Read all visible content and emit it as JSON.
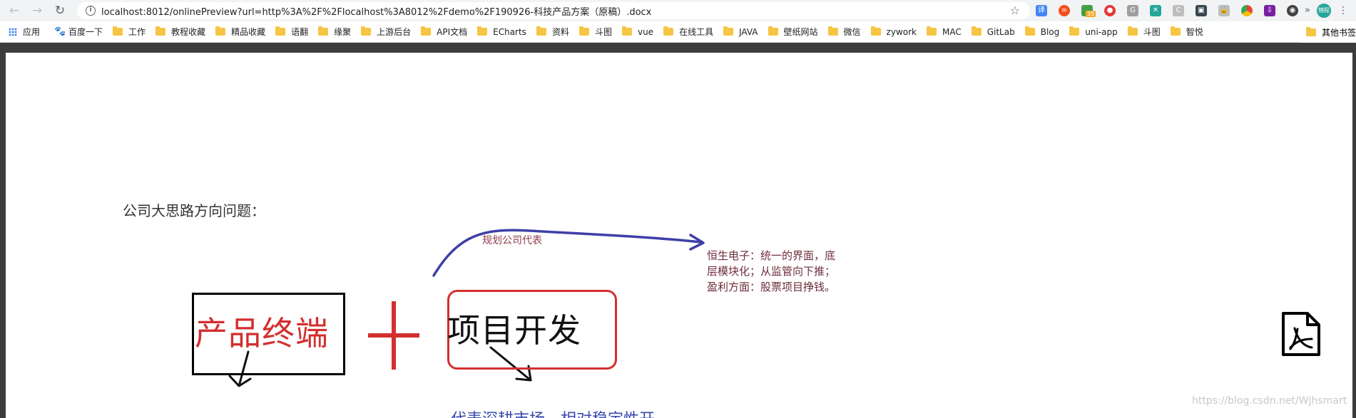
{
  "browser": {
    "url": "localhost:8012/onlinePreview?url=http%3A%2F%2Flocalhost%3A8012%2Fdemo%2F190926-科技产品方案（原稿）.docx",
    "extension_badge": "35",
    "profile_label": "锦程"
  },
  "bookmarks": {
    "apps_label": "应用",
    "baidu_label": "百度一下",
    "folders": [
      "工作",
      "教程收藏",
      "精品收藏",
      "语翻",
      "缘聚",
      "上游后台",
      "API文档",
      "ECharts",
      "资料",
      "斗图",
      "vue",
      "在线工具",
      "JAVA",
      "壁纸网站",
      "微信",
      "zywork",
      "MAC",
      "GitLab",
      "Blog",
      "uni-app",
      "斗图",
      "智悦"
    ],
    "more_label": "»",
    "other_label": "其他书签"
  },
  "document": {
    "heading": "公司大思路方向问题：",
    "box1_label": "产品终端",
    "box2_label": "项目开发",
    "arrow_label": "规划公司代表",
    "notes": [
      "恒生电子：统一的界面，底",
      "层模块化；从监管向下推；",
      "盈利方面：股票项目挣钱。"
    ],
    "bottom_text": "代表深耕市场，相对稳定性开"
  },
  "watermark": "https://blog.csdn.net/Wjhsmart",
  "colors": {
    "accent_red": "#d32f2f",
    "arrow_blue": "#3f3fa8",
    "note_color": "#6e2c3a"
  }
}
